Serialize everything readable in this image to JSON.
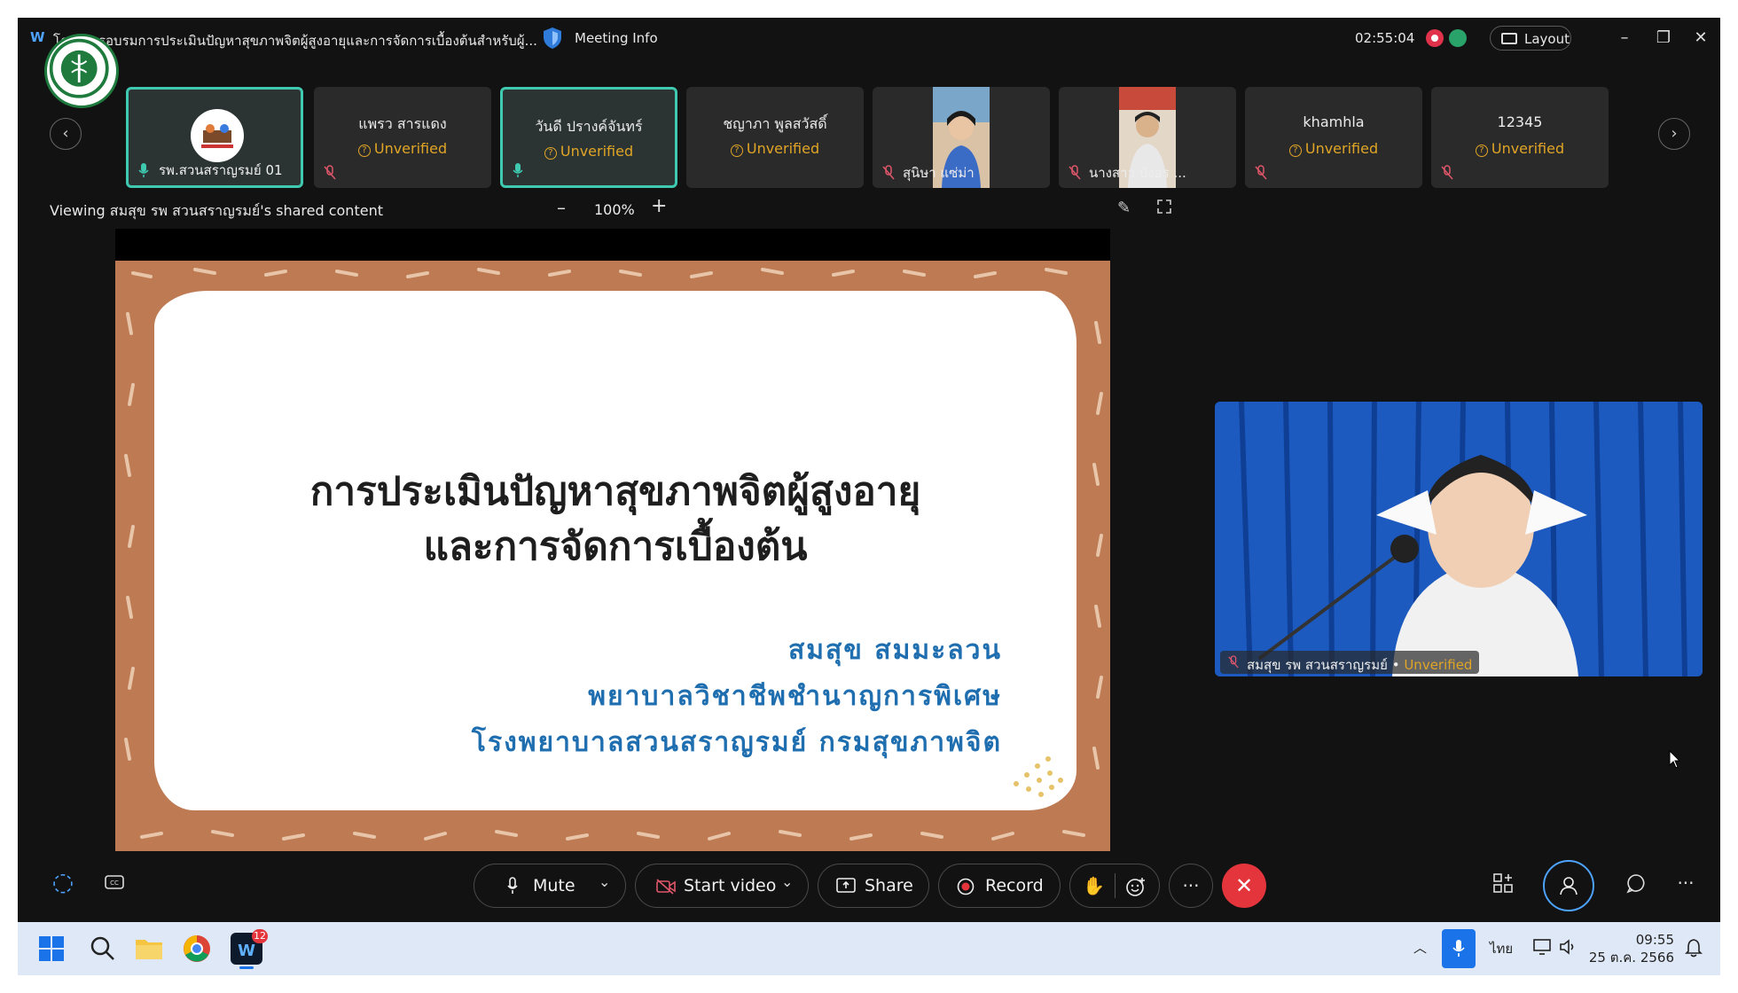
{
  "titlebar": {
    "app_icon": "webex-icon",
    "title": "โครงการอบรมการประเมินปัญหาสุขภาพจิตผู้สูงอายุและการจัดการเบื้องต้นสำหรับผู้...",
    "meeting_info": "Meeting Info",
    "elapsed": "02:55:04",
    "layout_label": "Layout",
    "minimize": "–",
    "restore": "❐",
    "close": "✕"
  },
  "participants": [
    {
      "name": "รพ.สวนสราญรมย์ 01",
      "status": "",
      "active": true
    },
    {
      "name": "แพรว สารแดง",
      "status": "Unverified"
    },
    {
      "name": "วันดี ปรางค์จันทร์",
      "status": "Unverified",
      "active": true
    },
    {
      "name": "ชญาภา  พูลสวัสดิ์",
      "status": "Unverified"
    },
    {
      "name": "สุนิษา แซ่ม่า",
      "status": ""
    },
    {
      "name": "นางสาว บังอร ...",
      "status": ""
    },
    {
      "name": "khamhla",
      "status": "Unverified"
    },
    {
      "name": "12345",
      "status": "Unverified"
    }
  ],
  "share": {
    "viewing_text": "Viewing สมสุข รพ สวนสราญรมย์'s shared content",
    "zoom_minus": "–",
    "zoom_value": "100%",
    "zoom_plus": "+"
  },
  "slide": {
    "title_line1": "การประเมินปัญหาสุขภาพจิตผู้สูงอายุ",
    "title_line2": "และการจัดการเบื้องต้น",
    "presenter": "สมสุข สมมะลวน",
    "position": "พยาบาลวิชาชีพชำนาญการพิเศษ",
    "organization": "โรงพยาบาลสวนสราญรมย์ กรมสุขภาพจิต",
    "bg_color": "#bd7a53",
    "sub_color": "#1f6fb0"
  },
  "speaker": {
    "name": "สมสุข รพ สวนสราญรมย์",
    "status": "Unverified"
  },
  "controls": {
    "mute": "Mute",
    "start_video": "Start video",
    "share": "Share",
    "record": "Record",
    "more": "···",
    "end": "✕",
    "more_right": "···"
  },
  "taskbar": {
    "lang": "ไทย",
    "time": "09:55",
    "date": "25 ต.ค. 2566",
    "badge": "12"
  },
  "colors": {
    "accent": "#3ec9b0",
    "unverified": "#e0a526",
    "end_call": "#e5353c"
  }
}
